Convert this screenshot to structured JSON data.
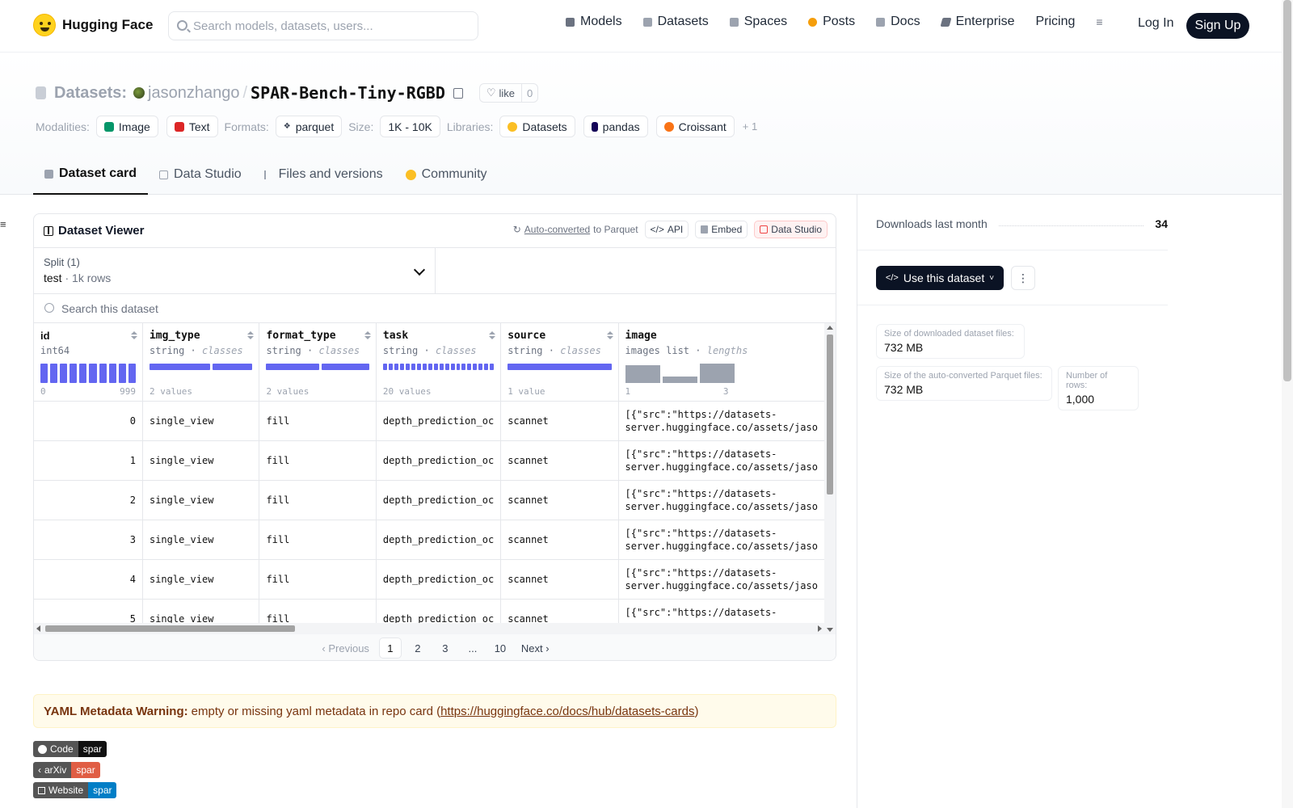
{
  "header": {
    "brand": "Hugging Face",
    "search_placeholder": "Search models, datasets, users...",
    "nav": [
      {
        "label": "Models",
        "icon": "cube-icon",
        "color": "#6b7280"
      },
      {
        "label": "Datasets",
        "icon": "database-icon",
        "color": "#9ca3af"
      },
      {
        "label": "Spaces",
        "icon": "grid-icon",
        "color": "#9ca3af"
      },
      {
        "label": "Posts",
        "icon": "speech-bubble-icon",
        "color": "#f59e0b"
      },
      {
        "label": "Docs",
        "icon": "book-icon",
        "color": "#9ca3af"
      },
      {
        "label": "Enterprise",
        "icon": "enterprise-icon",
        "color": "#6b7280"
      },
      {
        "label": "Pricing",
        "icon": "",
        "color": ""
      }
    ],
    "login": "Log In",
    "signup": "Sign Up"
  },
  "repo": {
    "type_label": "Datasets:",
    "user": "jasonzhango",
    "name": "SPAR-Bench-Tiny-RGBD",
    "like_label": "like",
    "like_count": "0"
  },
  "meta": {
    "modalities_label": "Modalities:",
    "modalities": [
      {
        "label": "Image",
        "color": "#059669"
      },
      {
        "label": "Text",
        "color": "#dc2626"
      }
    ],
    "formats_label": "Formats:",
    "formats": [
      {
        "label": "parquet"
      }
    ],
    "size_label": "Size:",
    "size": "1K - 10K",
    "libraries_label": "Libraries:",
    "libraries": [
      {
        "label": "Datasets",
        "color": "#fbbf24"
      },
      {
        "label": "pandas",
        "color": "#150458"
      },
      {
        "label": "Croissant",
        "color": "#f97316"
      }
    ],
    "more": "+ 1"
  },
  "tabs": [
    {
      "label": "Dataset card",
      "active": true
    },
    {
      "label": "Data Studio"
    },
    {
      "label": "Files and versions"
    },
    {
      "label": "Community"
    }
  ],
  "viewer": {
    "title": "Dataset Viewer",
    "auto_converted": "Auto-converted",
    "to_parquet": "to Parquet",
    "api": "API",
    "embed": "Embed",
    "data_studio": "Data Studio",
    "split_label": "Split (1)",
    "split_value": "test",
    "split_rows": "1k rows",
    "search_placeholder": "Search this dataset",
    "columns": [
      {
        "name": "id",
        "type": "int64",
        "kind": "",
        "caption_left": "0",
        "caption_right": "999"
      },
      {
        "name": "img_type",
        "type": "string",
        "kind": "classes",
        "caption_left": "2 values",
        "caption_right": ""
      },
      {
        "name": "format_type",
        "type": "string",
        "kind": "classes",
        "caption_left": "2 values",
        "caption_right": ""
      },
      {
        "name": "task",
        "type": "string",
        "kind": "classes",
        "caption_left": "20 values",
        "caption_right": ""
      },
      {
        "name": "source",
        "type": "string",
        "kind": "classes",
        "caption_left": "1 value",
        "caption_right": ""
      },
      {
        "name": "image",
        "type": "images list",
        "kind": "lengths",
        "caption_left": "1",
        "caption_right": "3"
      }
    ],
    "rows": [
      {
        "id": "0",
        "img_type": "single_view",
        "format_type": "fill",
        "task": "depth_prediction_oc",
        "source": "scannet",
        "image_1": "[{\"src\":\"https://datasets-",
        "image_2": "server.huggingface.co/assets/jaso"
      },
      {
        "id": "1",
        "img_type": "single_view",
        "format_type": "fill",
        "task": "depth_prediction_oc",
        "source": "scannet",
        "image_1": "[{\"src\":\"https://datasets-",
        "image_2": "server.huggingface.co/assets/jaso"
      },
      {
        "id": "2",
        "img_type": "single_view",
        "format_type": "fill",
        "task": "depth_prediction_oc",
        "source": "scannet",
        "image_1": "[{\"src\":\"https://datasets-",
        "image_2": "server.huggingface.co/assets/jaso"
      },
      {
        "id": "3",
        "img_type": "single_view",
        "format_type": "fill",
        "task": "depth_prediction_oc",
        "source": "scannet",
        "image_1": "[{\"src\":\"https://datasets-",
        "image_2": "server.huggingface.co/assets/jaso"
      },
      {
        "id": "4",
        "img_type": "single_view",
        "format_type": "fill",
        "task": "depth_prediction_oc",
        "source": "scannet",
        "image_1": "[{\"src\":\"https://datasets-",
        "image_2": "server.huggingface.co/assets/jaso"
      },
      {
        "id": "5",
        "img_type": "single_view",
        "format_type": "fill",
        "task": "depth_prediction_oc",
        "source": "scannet",
        "image_1": "[{\"src\":\"https://datasets-",
        "image_2": ""
      }
    ],
    "pager": {
      "prev": "Previous",
      "pages": [
        "1",
        "2",
        "3",
        "...",
        "10"
      ],
      "next": "Next"
    }
  },
  "warning": {
    "bold": "YAML Metadata Warning:",
    "text": "empty or missing yaml metadata in repo card (",
    "link": "https://huggingface.co/docs/hub/datasets-cards",
    "close": ")"
  },
  "badges": [
    {
      "key": "Code",
      "value": "spar",
      "color": "#111111"
    },
    {
      "key": "arXiv",
      "value": "spar",
      "color": "#e05d44"
    },
    {
      "key": "Website",
      "value": "spar",
      "color": "#007ec6"
    }
  ],
  "sidebar": {
    "downloads_label": "Downloads last month",
    "downloads_value": "34",
    "use_button": "Use this dataset",
    "stats": [
      {
        "label": "Size of downloaded dataset files:",
        "value": "732 MB"
      },
      {
        "label": "Size of the auto-converted Parquet files:",
        "value": "732 MB"
      },
      {
        "label": "Number of rows:",
        "value": "1,000"
      }
    ]
  }
}
